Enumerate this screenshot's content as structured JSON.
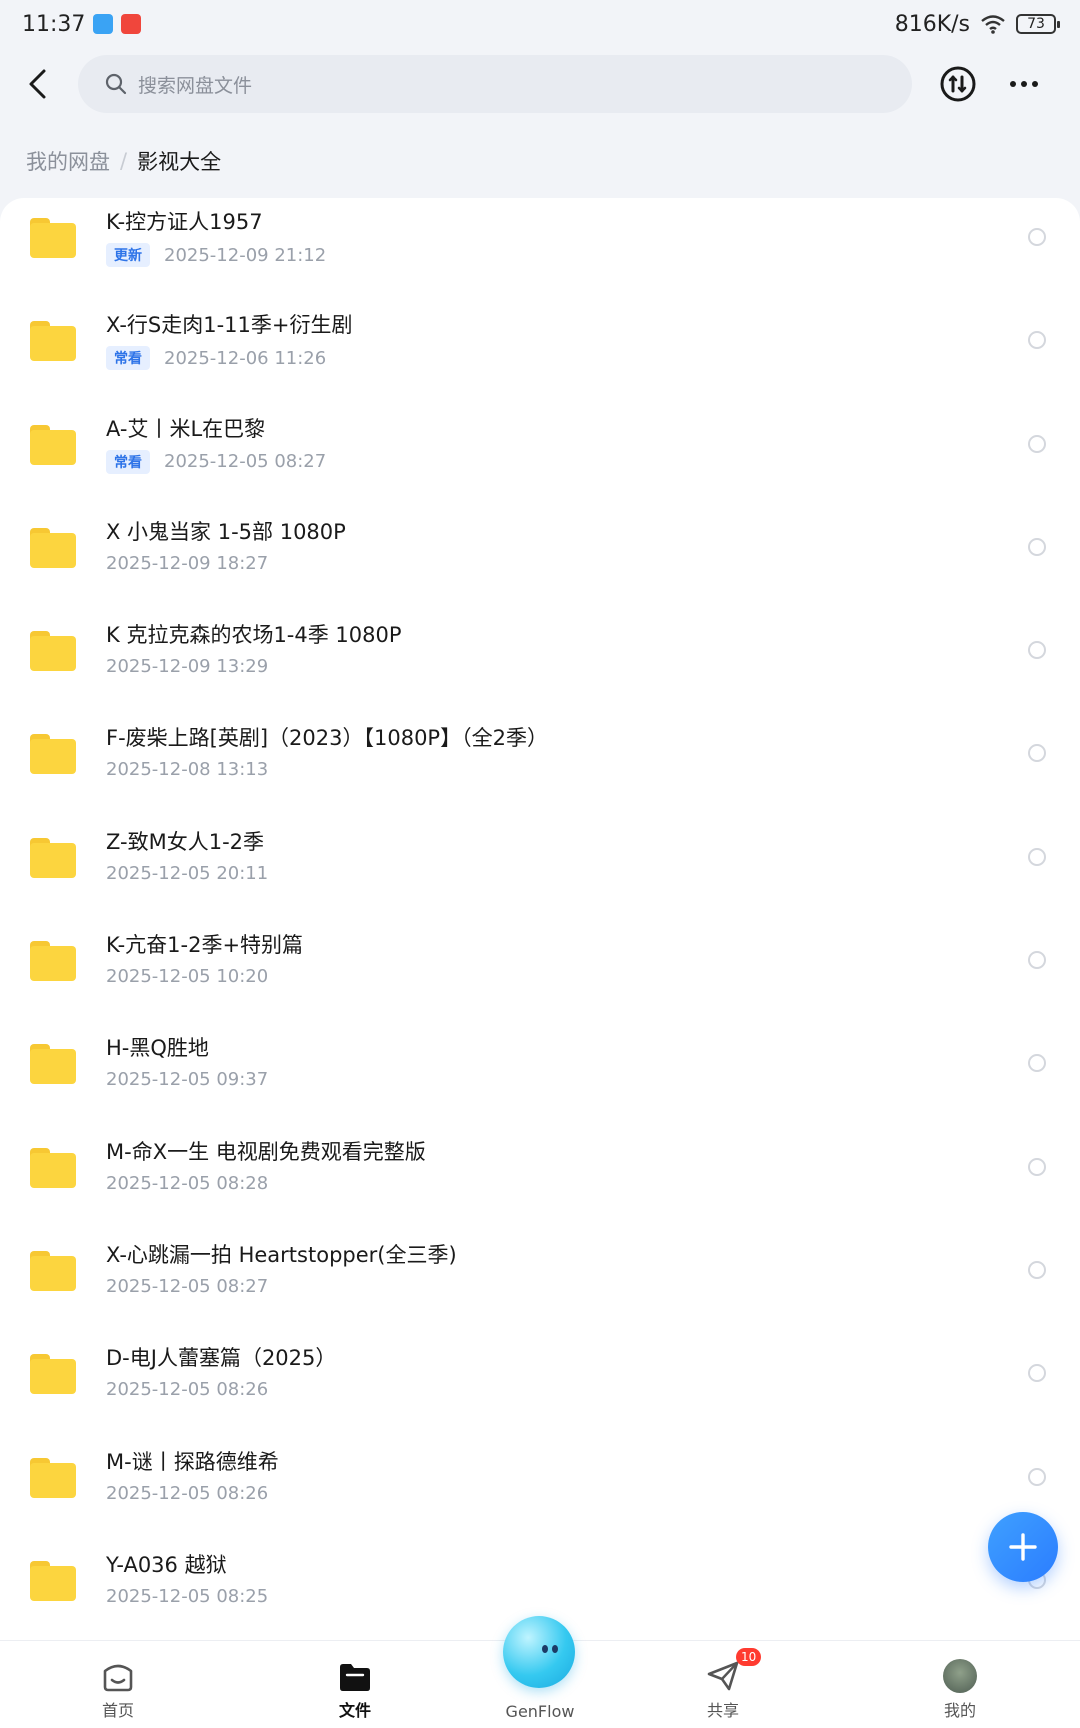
{
  "status_bar": {
    "time": "11:37",
    "speed": "816K/s",
    "battery": "73"
  },
  "search": {
    "placeholder": "搜索网盘文件"
  },
  "breadcrumb": {
    "root": "我的网盘",
    "separator": "/",
    "current": "影视大全"
  },
  "files": [
    {
      "name": "K-控方证人1957",
      "tag": "更新",
      "date": "2025-12-09  21:12"
    },
    {
      "name": "X-行S走肉1-11季+衍生剧",
      "tag": "常看",
      "date": "2025-12-06  11:26"
    },
    {
      "name": "A-艾丨米L在巴黎",
      "tag": "常看",
      "date": "2025-12-05  08:27"
    },
    {
      "name": "X 小鬼当家 1-5部 1080P",
      "tag": "",
      "date": "2025-12-09  18:27"
    },
    {
      "name": "K 克拉克森的农场1-4季 1080P",
      "tag": "",
      "date": "2025-12-09  13:29"
    },
    {
      "name": "F-废柴上路[英剧]（2023）【1080P】（全2季）",
      "tag": "",
      "date": "2025-12-08  13:13"
    },
    {
      "name": "Z-致M女人1-2季",
      "tag": "",
      "date": "2025-12-05  20:11"
    },
    {
      "name": "K-亢奋1-2季+特别篇",
      "tag": "",
      "date": "2025-12-05  10:20"
    },
    {
      "name": "H-黑Q胜地",
      "tag": "",
      "date": "2025-12-05  09:37"
    },
    {
      "name": "M-命X一生 电视剧免费观看完整版",
      "tag": "",
      "date": "2025-12-05  08:28"
    },
    {
      "name": "X-心跳漏一拍 Heartstopper(全三季)",
      "tag": "",
      "date": "2025-12-05  08:27"
    },
    {
      "name": "D-电J人蕾塞篇（2025）",
      "tag": "",
      "date": "2025-12-05  08:26"
    },
    {
      "name": "M-谜丨探路德维希",
      "tag": "",
      "date": "2025-12-05  08:26"
    },
    {
      "name": "Y-A036 越狱",
      "tag": "",
      "date": "2025-12-05  08:25"
    }
  ],
  "nav": {
    "home": "首页",
    "files": "文件",
    "genflow": "GenFlow",
    "share": "共享",
    "share_badge": "10",
    "mine": "我的"
  },
  "colors": {
    "accent": "#2b7dff",
    "folder": "#fcd53f",
    "tag_text": "#2e74e8",
    "tag_bg": "#e6efff",
    "badge": "#ff3b30"
  }
}
